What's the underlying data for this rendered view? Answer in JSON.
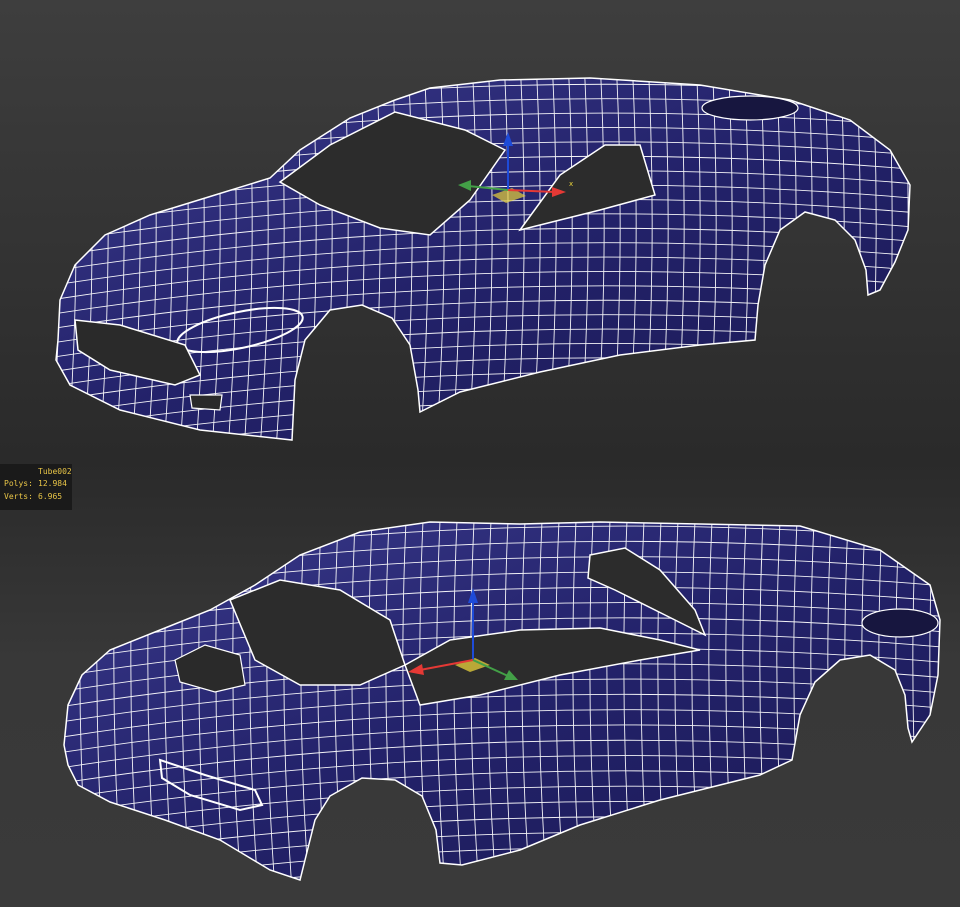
{
  "object_stats": {
    "object_name": "Tube002",
    "polys_label": "Polys:",
    "polys_value": "12.984",
    "verts_label": "Verts:",
    "verts_value": "6.965"
  },
  "viewports": [
    {
      "id": "top",
      "gizmo_axis_label": "x"
    },
    {
      "id": "bottom",
      "gizmo_axis_label": ""
    }
  ],
  "colors": {
    "mesh_fill": "#23226a",
    "mesh_fill_highlight": "#3a3a8c",
    "wire": "#ffffff",
    "axis_x": "#e53935",
    "axis_y": "#43a047",
    "axis_z": "#1e4bd8",
    "gizmo_plane": "#e8d23b",
    "stats_text": "#e8c547"
  }
}
